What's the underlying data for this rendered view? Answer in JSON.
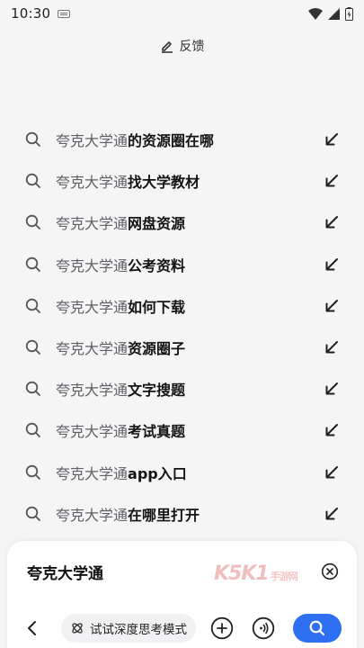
{
  "status_bar": {
    "time": "10:30",
    "icons": [
      "keyboard-icon",
      "wifi-icon",
      "signal-icon",
      "battery-icon"
    ]
  },
  "feedback": {
    "label": "反馈",
    "icon": "edit-icon"
  },
  "suggestions": [
    {
      "prefix": "夸克大学通",
      "suffix": "的资源圈在哪"
    },
    {
      "prefix": "夸克大学通",
      "suffix": "找大学教材"
    },
    {
      "prefix": "夸克大学通",
      "suffix": "网盘资源"
    },
    {
      "prefix": "夸克大学通",
      "suffix": "公考资料"
    },
    {
      "prefix": "夸克大学通",
      "suffix": "如何下载"
    },
    {
      "prefix": "夸克大学通",
      "suffix": "资源圈子"
    },
    {
      "prefix": "夸克大学通",
      "suffix": "文字搜题"
    },
    {
      "prefix": "夸克大学通",
      "suffix": "考试真题"
    },
    {
      "prefix": "夸克大学通",
      "suffix": "app入口"
    },
    {
      "prefix": "夸克大学通",
      "suffix": "在哪里打开"
    }
  ],
  "search_box": {
    "query": "夸克大学通",
    "watermark": "K5K1",
    "watermark_sub": "手游网"
  },
  "toolbar": {
    "deep_think_label": "试试深度思考模式",
    "search_color": "#2f6ff2"
  }
}
